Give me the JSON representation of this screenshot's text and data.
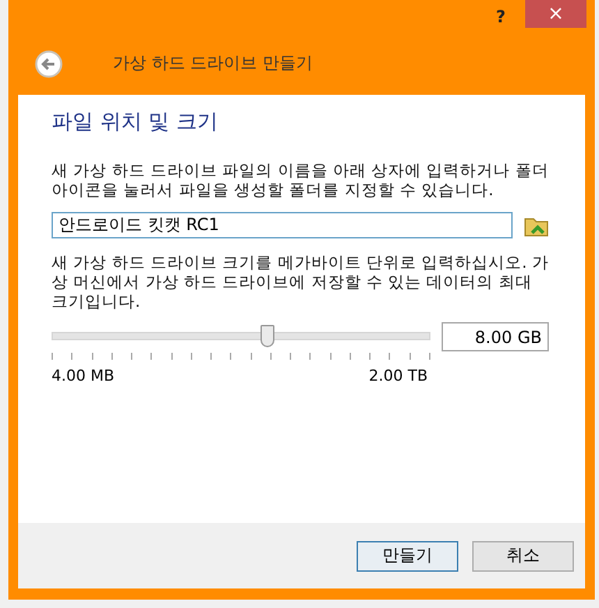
{
  "window": {
    "help": "?",
    "close": "×"
  },
  "header": {
    "title": "가상 하드 드라이브 만들기"
  },
  "page": {
    "heading": "파일 위치 및 크기",
    "location_text": "새 가상 하드 드라이브 파일의 이름을 아래 상자에 입력하거나 폴더 아이콘을 눌러서 파일을 생성할 폴더를 지정할 수 있습니다.",
    "file_name": "안드로이드 킷캣 RC1",
    "size_text": "새 가상 하드 드라이브 크기를 메가바이트 단위로 입력하십시오. 가상 머신에서 가상 하드 드라이브에 저장할 수 있는 데이터의 최대 크기입니다.",
    "slider": {
      "level": 0.57,
      "min_label": "4.00 MB",
      "max_label": "2.00 TB"
    },
    "size_value": "8.00 GB"
  },
  "buttons": [
    {
      "label": "만들기",
      "selected": true
    },
    {
      "label": "취소",
      "selected": false
    }
  ]
}
